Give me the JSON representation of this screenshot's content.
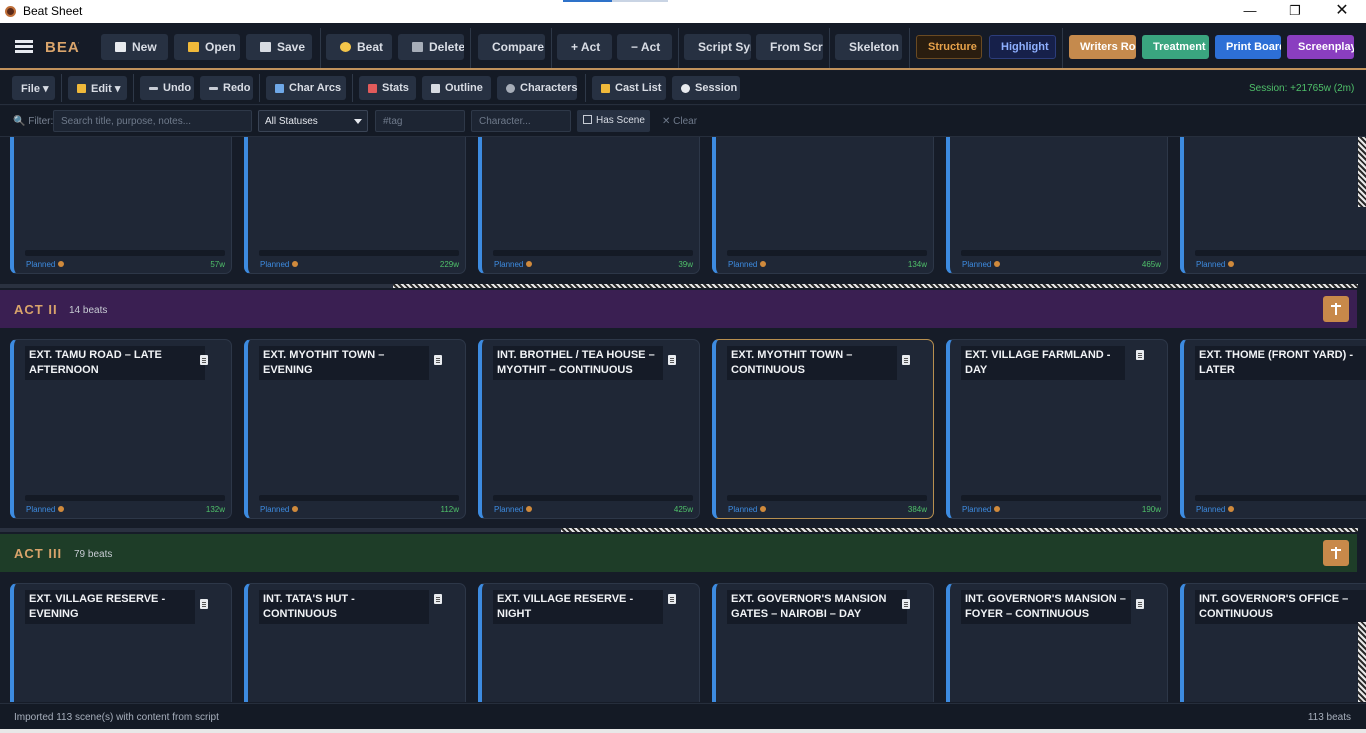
{
  "window": {
    "title": "Beat Sheet",
    "min": "—",
    "max": "❐",
    "close": "✕"
  },
  "logo": {
    "text": "BEAT SHEET"
  },
  "toolbar": {
    "new": "New",
    "open": "Open",
    "save": "Save",
    "beat": "Beat",
    "delete": "Delete",
    "compare": "Compare",
    "add_act": "+ Act",
    "remove_act": "− Act",
    "script_sync": "Script Sync",
    "from_script": "From Script",
    "skeleton": "Skeleton",
    "structure": "Structure",
    "highlight": "Highlight",
    "writers_room": "Writers Room",
    "treatment": "Treatment",
    "print_board": "Print Board",
    "screenplay": "Screenplay"
  },
  "toolbar2": {
    "file": "File ▾",
    "edit": "Edit ▾",
    "undo": "Undo",
    "redo": "Redo",
    "char_arcs": "Char Arcs",
    "stats": "Stats",
    "outline": "Outline",
    "characters": "Characters",
    "cast_list": "Cast List",
    "session": "Session",
    "session_info": "Session: +21765w  (2m)"
  },
  "filter": {
    "label": "Filter:",
    "search_placeholder": "Search title, purpose, notes...",
    "status_value": "All Statuses",
    "tag_placeholder": "#tag",
    "character_placeholder": "Character...",
    "has_scene": "Has Scene",
    "clear": "✕ Clear"
  },
  "acts": [
    {
      "name": "",
      "count": "",
      "cards": [
        {
          "title": "",
          "status": "Planned",
          "words": "57w"
        },
        {
          "title": "",
          "status": "Planned",
          "words": "229w"
        },
        {
          "title": "",
          "status": "Planned",
          "words": "39w"
        },
        {
          "title": "",
          "status": "Planned",
          "words": "134w"
        },
        {
          "title": "",
          "status": "Planned",
          "words": "465w"
        },
        {
          "title": "",
          "status": "Planned",
          "words": ""
        }
      ]
    },
    {
      "name": "ACT II",
      "count": "14 beats",
      "cards": [
        {
          "title": "EXT.  TAMU ROAD – LATE AFTERNOON",
          "status": "Planned",
          "words": "132w"
        },
        {
          "title": "EXT. MYOTHIT TOWN – EVENING",
          "status": "Planned",
          "words": "112w"
        },
        {
          "title": "INT. BROTHEL / TEA HOUSE – MYOTHIT – CONTINUOUS",
          "status": "Planned",
          "words": "425w"
        },
        {
          "title": "EXT. MYOTHIT TOWN – CONTINUOUS",
          "status": "Planned",
          "words": "384w"
        },
        {
          "title": "EXT. VILLAGE FARMLAND - DAY",
          "status": "Planned",
          "words": "190w"
        },
        {
          "title": "EXT. THOME (FRONT YARD) - LATER",
          "status": "Planned",
          "words": ""
        }
      ]
    },
    {
      "name": "ACT III",
      "count": "79 beats",
      "cards": [
        {
          "title": "EXT. VILLAGE RESERVE - EVENING"
        },
        {
          "title": "INT. TATA'S HUT - CONTINUOUS"
        },
        {
          "title": "EXT. VILLAGE RESERVE - NIGHT"
        },
        {
          "title": "EXT. GOVERNOR'S MANSION GATES – NAIROBI – DAY"
        },
        {
          "title": "INT. GOVERNOR'S MANSION – FOYER – CONTINUOUS"
        },
        {
          "title": "INT. GOVERNOR'S OFFICE – CONTINUOUS"
        }
      ]
    }
  ],
  "status": {
    "message": "Imported 113 scene(s) with content from script",
    "total": "113 beats"
  },
  "colors": {
    "accent": "#d9a46b",
    "card_border_left": "#3d8be0",
    "act2_bg": "#3a1f52",
    "act3_bg": "#1e3d28",
    "words_green": "#4fc06a"
  }
}
